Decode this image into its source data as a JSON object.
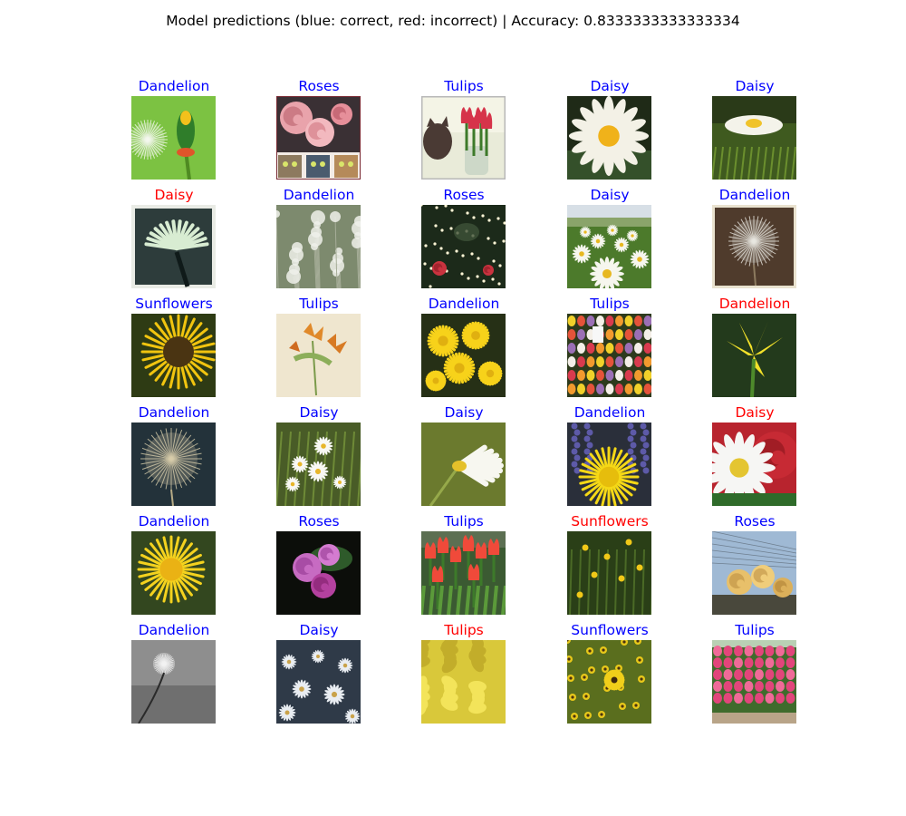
{
  "title": "Model predictions (blue: correct, red: incorrect) | Accuracy: 0.8333333333333334",
  "colors": {
    "correct": "#0000ff",
    "incorrect": "#ff0000"
  },
  "chart_data": {
    "type": "image-grid",
    "rows": 6,
    "cols": 5,
    "accuracy": 0.8333333333333334,
    "predictions": [
      {
        "label": "Dandelion",
        "correct": true,
        "image": "dandelion-bud-on-green"
      },
      {
        "label": "Roses",
        "correct": true,
        "image": "pink-roses-collage-with-cats"
      },
      {
        "label": "Tulips",
        "correct": true,
        "image": "cat-with-vase-of-red-tulips"
      },
      {
        "label": "Daisy",
        "correct": true,
        "image": "white-daisy-close-up"
      },
      {
        "label": "Daisy",
        "correct": true,
        "image": "daisy-in-grass"
      },
      {
        "label": "Daisy",
        "correct": false,
        "image": "pale-dandelion-vintage-frame"
      },
      {
        "label": "Dandelion",
        "correct": true,
        "image": "dandelion-seed-heads-field"
      },
      {
        "label": "Roses",
        "correct": true,
        "image": "dark-bush-with-lights-and-red-roses"
      },
      {
        "label": "Daisy",
        "correct": true,
        "image": "daisy-meadow"
      },
      {
        "label": "Dandelion",
        "correct": true,
        "image": "dandelion-puffball-brown-frame"
      },
      {
        "label": "Sunflowers",
        "correct": true,
        "image": "sunflower-close-up"
      },
      {
        "label": "Tulips",
        "correct": true,
        "image": "botanical-illustration-lilies"
      },
      {
        "label": "Dandelion",
        "correct": true,
        "image": "yellow-dandelion-flowers"
      },
      {
        "label": "Tulips",
        "correct": true,
        "image": "colorful-tulip-market"
      },
      {
        "label": "Dandelion",
        "correct": false,
        "image": "yellow-tulip-on-dark-green"
      },
      {
        "label": "Dandelion",
        "correct": true,
        "image": "dandelion-seed-head-dark"
      },
      {
        "label": "Daisy",
        "correct": true,
        "image": "daisies-in-foliage"
      },
      {
        "label": "Daisy",
        "correct": true,
        "image": "white-daisy-side-view"
      },
      {
        "label": "Dandelion",
        "correct": true,
        "image": "yellow-dandelion-with-purple-hyacinths"
      },
      {
        "label": "Daisy",
        "correct": false,
        "image": "daisy-and-red-rose"
      },
      {
        "label": "Dandelion",
        "correct": true,
        "image": "yellow-dandelion-flower"
      },
      {
        "label": "Roses",
        "correct": true,
        "image": "pink-roses-on-black"
      },
      {
        "label": "Tulips",
        "correct": true,
        "image": "red-tulips-row"
      },
      {
        "label": "Sunflowers",
        "correct": false,
        "image": "small-yellow-flowers-dark-green"
      },
      {
        "label": "Roses",
        "correct": true,
        "image": "yellow-roses-against-sky"
      },
      {
        "label": "Dandelion",
        "correct": true,
        "image": "grayscale-dandelion-seed-head"
      },
      {
        "label": "Daisy",
        "correct": true,
        "image": "daisies-blue-toned"
      },
      {
        "label": "Tulips",
        "correct": false,
        "image": "yellow-flower-mass"
      },
      {
        "label": "Sunflowers",
        "correct": true,
        "image": "sunflower-field"
      },
      {
        "label": "Tulips",
        "correct": true,
        "image": "pink-tulip-field"
      }
    ]
  }
}
